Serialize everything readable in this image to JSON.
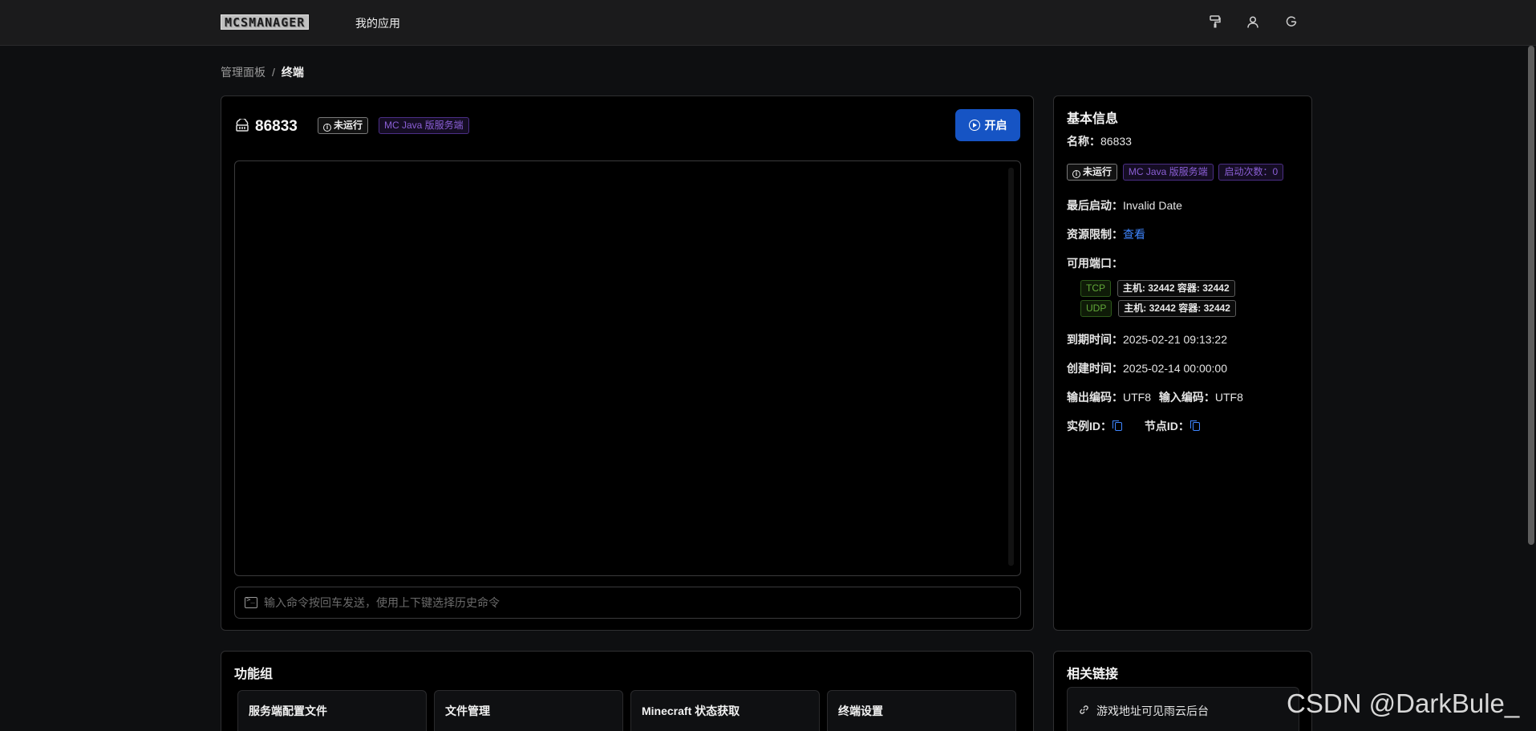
{
  "topbar": {
    "logo_text": "MCSMANAGER",
    "nav_app_label": "我的应用",
    "icons": [
      "paint-roller-icon",
      "user-icon",
      "logout-icon"
    ]
  },
  "breadcrumb": {
    "root": "管理面板",
    "separator": "/",
    "current": "终端"
  },
  "instance": {
    "name": "86833",
    "status": "未运行",
    "type": "MC Java 版服务端",
    "start_label": "开启",
    "command_placeholder": "输入命令按回车发送，使用上下键选择历史命令"
  },
  "info": {
    "title": "基本信息",
    "name_label": "名称：",
    "name_value": "86833",
    "status_tag": "未运行",
    "type_tag": "MC Java 版服务端",
    "start_count_tag": "启动次数：0",
    "last_start_label": "最后启动：",
    "last_start_value": "Invalid Date",
    "resource_label": "资源限制：",
    "resource_link": "查看",
    "ports_label": "可用端口：",
    "ports": [
      {
        "proto": "TCP",
        "mapping": "主机: 32442 容器: 32442"
      },
      {
        "proto": "UDP",
        "mapping": "主机: 32442 容器: 32442"
      }
    ],
    "expire_label": "到期时间：",
    "expire_value": "2025-02-21 09:13:22",
    "created_label": "创建时间：",
    "created_value": "2025-02-14 00:00:00",
    "output_enc_label": "输出编码：",
    "output_enc_value": "UTF8",
    "input_enc_label": "输入编码：",
    "input_enc_value": "UTF8",
    "instance_id_label": "实例ID：",
    "node_id_label": "节点ID："
  },
  "functions": {
    "title": "功能组",
    "items": [
      "服务端配置文件",
      "文件管理",
      "Minecraft 状态获取",
      "终端设置"
    ]
  },
  "links": {
    "title": "相关链接",
    "items": [
      "游戏地址可见雨云后台"
    ]
  },
  "watermark": "CSDN @DarkBule_",
  "colors": {
    "accent": "#1654c4",
    "link": "#3f86ff",
    "purple_tag": "#8b5fd6",
    "green_tag": "#62a83a"
  }
}
